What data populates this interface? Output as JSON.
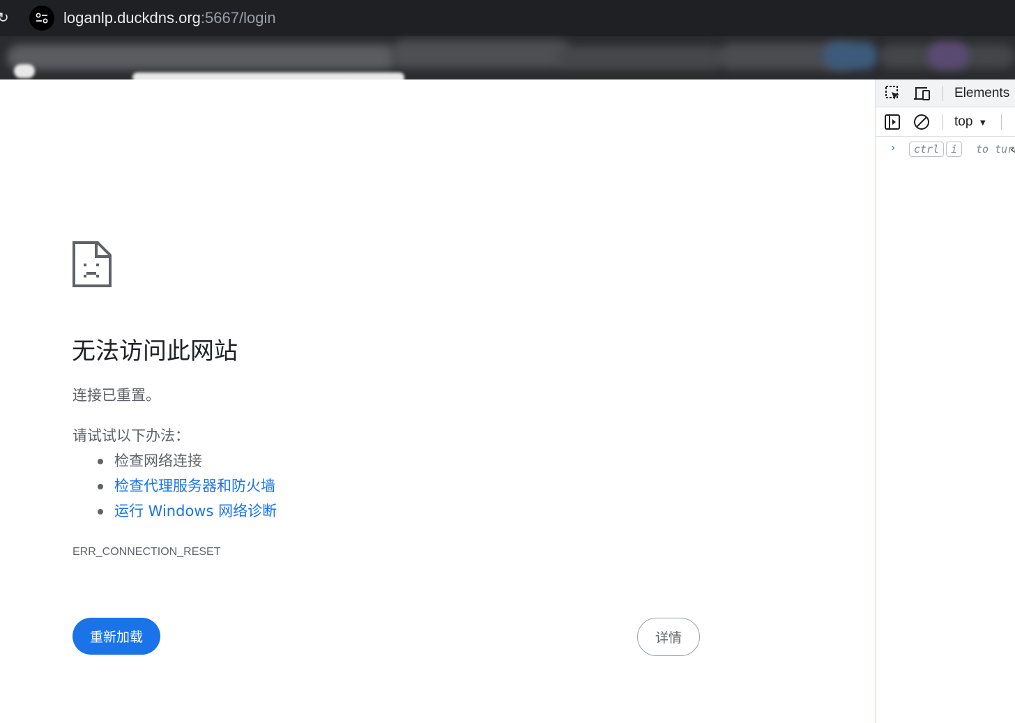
{
  "browser": {
    "url_host": "loganlp.duckdns.org",
    "url_rest": ":5667/login"
  },
  "error_page": {
    "title": "无法访问此网站",
    "subtitle": "连接已重置。",
    "try_label": "请试试以下办法：",
    "suggestions": [
      {
        "label": "检查网络连接",
        "link": false
      },
      {
        "label": "检查代理服务器和防火墙",
        "link": true
      },
      {
        "label": "运行 Windows 网络诊断",
        "link": true
      }
    ],
    "error_code": "ERR_CONNECTION_RESET",
    "reload_button": "重新加载",
    "details_button": "详情"
  },
  "devtools": {
    "tab_elements": "Elements",
    "context": "top",
    "console_hint_key1": "ctrl",
    "console_hint_key2": "i",
    "console_hint_text": "to turn"
  },
  "colors": {
    "accent": "#1a73e8",
    "text_secondary": "#5f6368",
    "chrome_bg": "#202124"
  }
}
